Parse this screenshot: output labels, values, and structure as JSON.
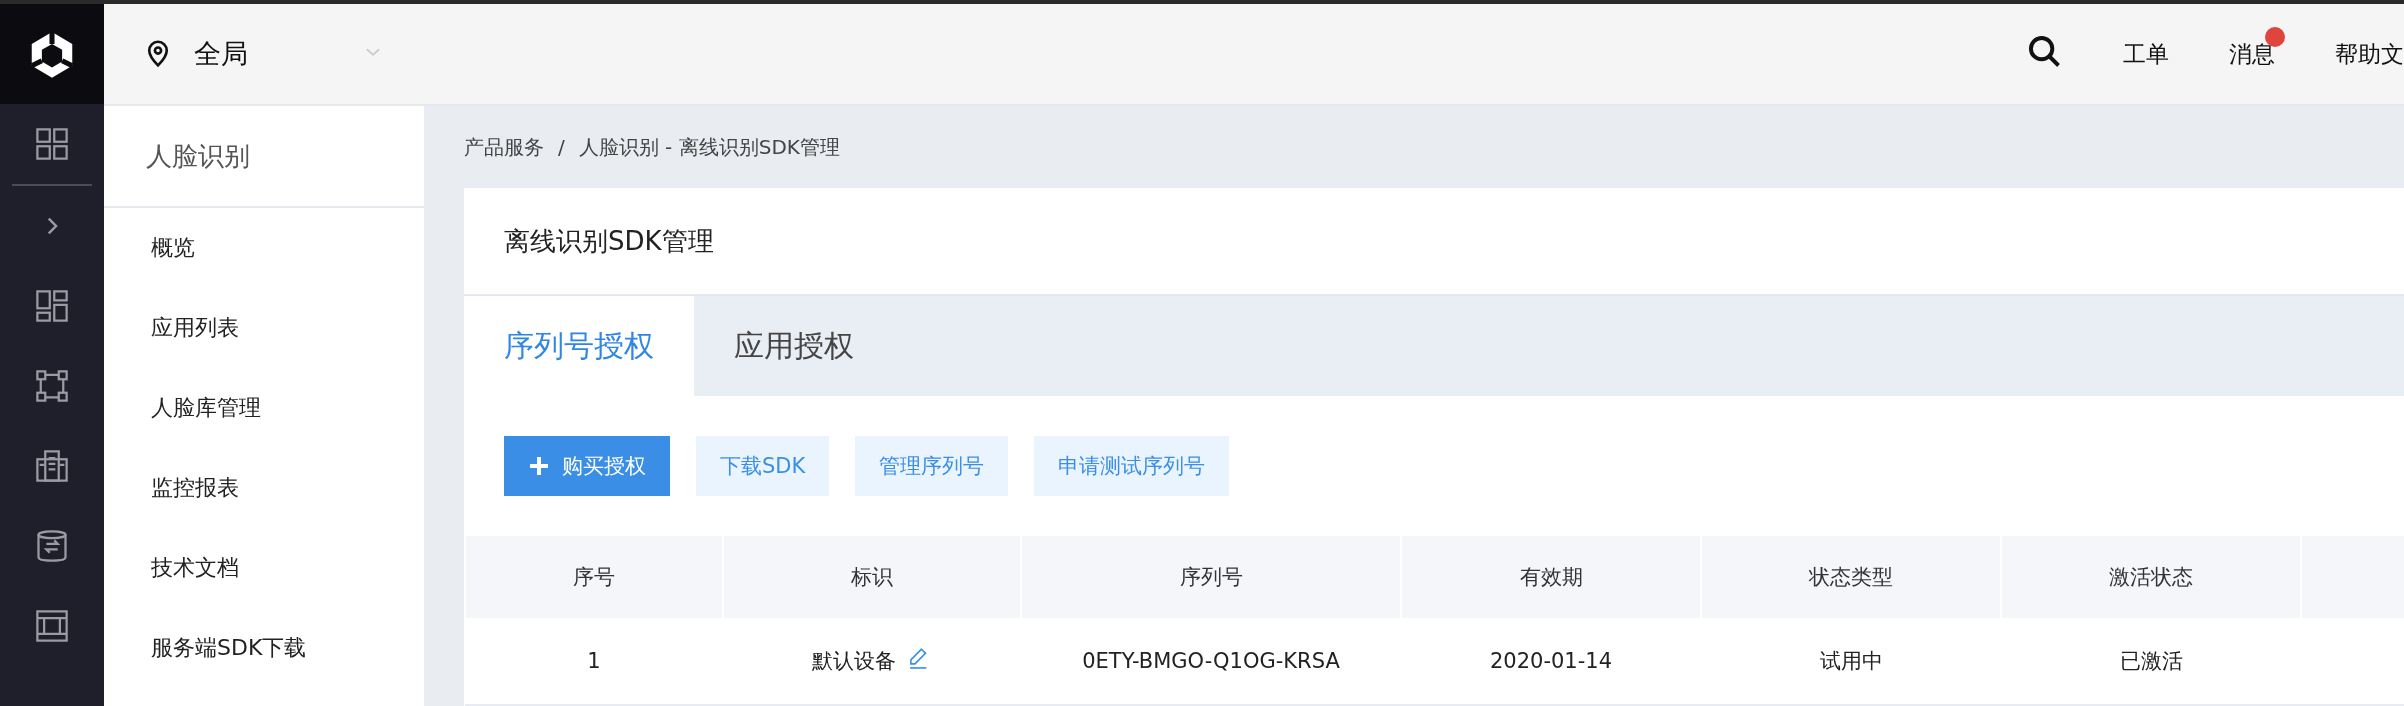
{
  "header": {
    "region": "全局",
    "links": [
      {
        "label": "工单",
        "badge": false
      },
      {
        "label": "消息",
        "badge": true
      },
      {
        "label": "帮助文",
        "badge": false
      }
    ]
  },
  "sidebar": {
    "title": "人脸识别",
    "items": [
      {
        "label": "概览"
      },
      {
        "label": "应用列表"
      },
      {
        "label": "人脸库管理"
      },
      {
        "label": "监控报表"
      },
      {
        "label": "技术文档"
      },
      {
        "label": "服务端SDK下载"
      }
    ]
  },
  "breadcrumb": {
    "separator": "/",
    "items": [
      "产品服务",
      "人脸识别 - 离线识别SDK管理"
    ]
  },
  "card": {
    "title": "离线识别SDK管理"
  },
  "tabs": [
    {
      "label": "序列号授权",
      "selected": true
    },
    {
      "label": "应用授权",
      "selected": false
    }
  ],
  "buttons": [
    {
      "label": "购买授权",
      "kind": "primary"
    },
    {
      "label": "下载SDK",
      "kind": "light"
    },
    {
      "label": "管理序列号",
      "kind": "light"
    },
    {
      "label": "申请测试序列号",
      "kind": "light"
    }
  ],
  "table": {
    "columns": [
      "序号",
      "标识",
      "序列号",
      "有效期",
      "状态类型",
      "激活状态"
    ],
    "rows": [
      {
        "cells": [
          "1",
          "默认设备",
          "0ETY-BMGO-Q1OG-KRSA",
          "2020-01-14",
          "试用中",
          "已激活"
        ],
        "editable": true
      }
    ]
  }
}
